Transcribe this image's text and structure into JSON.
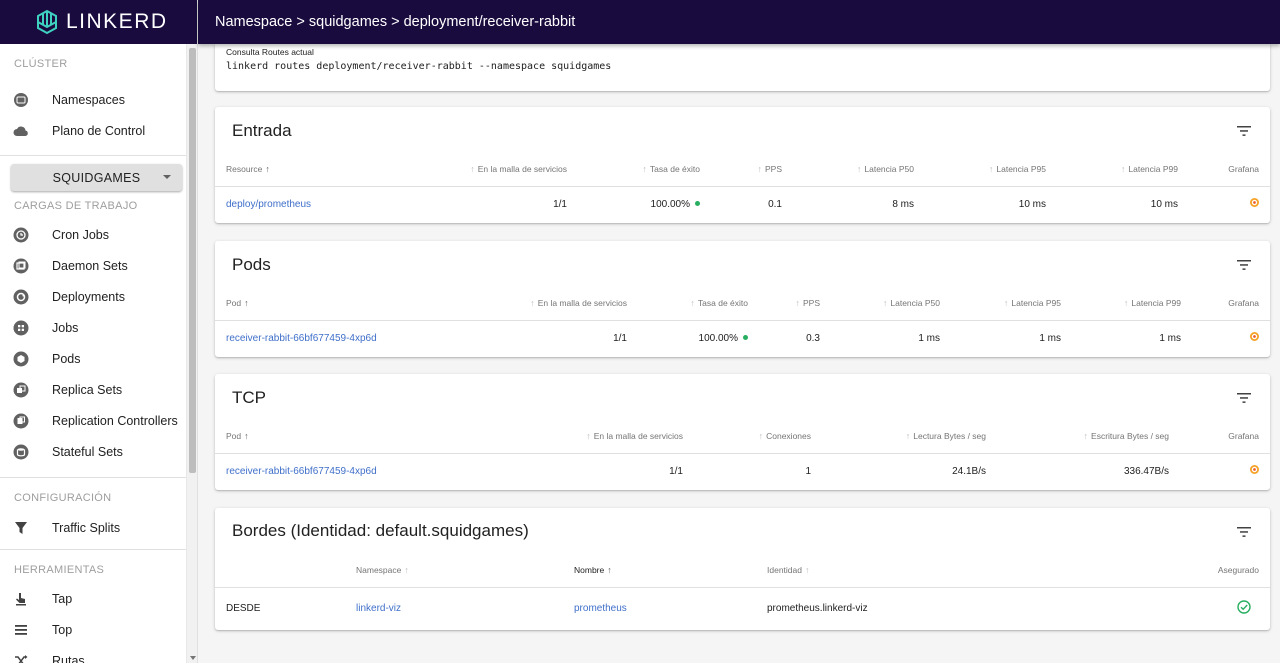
{
  "brand": {
    "name": "LINKERD",
    "color": "#1a0b3f"
  },
  "header": {
    "title": "Namespace > squidgames > deployment/receiver-rabbit"
  },
  "sidebar": {
    "cluster_label": "CLÚSTER",
    "cluster_items": [
      {
        "label": "Namespaces",
        "icon": "namespaces-icon"
      },
      {
        "label": "Plano de Control",
        "icon": "cloud-icon"
      }
    ],
    "namespace_select": "SQUIDGAMES",
    "workloads_label": "CARGAS DE TRABAJO",
    "workload_items": [
      {
        "label": "Cron Jobs",
        "icon": "cronjob-icon"
      },
      {
        "label": "Daemon Sets",
        "icon": "daemonset-icon"
      },
      {
        "label": "Deployments",
        "icon": "deployment-icon"
      },
      {
        "label": "Jobs",
        "icon": "job-icon"
      },
      {
        "label": "Pods",
        "icon": "pod-icon"
      },
      {
        "label": "Replica Sets",
        "icon": "replicaset-icon"
      },
      {
        "label": "Replication Controllers",
        "icon": "replicationcontroller-icon"
      },
      {
        "label": "Stateful Sets",
        "icon": "statefulset-icon"
      }
    ],
    "config_label": "CONFIGURACIÓN",
    "config_items": [
      {
        "label": "Traffic Splits",
        "icon": "filter-icon"
      }
    ],
    "tools_label": "HERRAMIENTAS",
    "tool_items": [
      {
        "label": "Tap",
        "icon": "tap-icon"
      },
      {
        "label": "Top",
        "icon": "top-icon"
      },
      {
        "label": "Rutas",
        "icon": "shuffle-icon"
      }
    ]
  },
  "routes_card": {
    "label": "Consulta Routes actual",
    "command": "linkerd routes deployment/receiver-rabbit --namespace squidgames"
  },
  "entrada": {
    "title": "Entrada",
    "headers": [
      "Resource",
      "En la malla de servicios",
      "Tasa de éxito",
      "PPS",
      "Latencia P50",
      "Latencia P95",
      "Latencia P99",
      "Grafana"
    ],
    "rows": [
      {
        "resource": "deploy/prometheus",
        "meshed": "1/1",
        "success": "100.00%",
        "rps": "0.1",
        "p50": "8 ms",
        "p95": "10 ms",
        "p99": "10 ms"
      }
    ]
  },
  "pods": {
    "title": "Pods",
    "headers": [
      "Pod",
      "En la malla de servicios",
      "Tasa de éxito",
      "PPS",
      "Latencia P50",
      "Latencia P95",
      "Latencia P99",
      "Grafana"
    ],
    "rows": [
      {
        "pod": "receiver-rabbit-66bf677459-4xp6d",
        "meshed": "1/1",
        "success": "100.00%",
        "rps": "0.3",
        "p50": "1 ms",
        "p95": "1 ms",
        "p99": "1 ms"
      }
    ]
  },
  "tcp": {
    "title": "TCP",
    "headers": [
      "Pod",
      "En la malla de servicios",
      "Conexiones",
      "Lectura Bytes / seg",
      "Escritura Bytes / seg",
      "Grafana"
    ],
    "rows": [
      {
        "pod": "receiver-rabbit-66bf677459-4xp6d",
        "meshed": "1/1",
        "connections": "1",
        "read": "24.1B/s",
        "write": "336.47B/s"
      }
    ]
  },
  "edges": {
    "title": "Bordes (Identidad: default.squidgames)",
    "headers": [
      "",
      "Namespace",
      "Nombre",
      "Identidad",
      "Asegurado"
    ],
    "rows": [
      {
        "direction": "DESDE",
        "namespace": "linkerd-viz",
        "name": "prometheus",
        "identity": "prometheus.linkerd-viz"
      }
    ]
  },
  "colors": {
    "success": "#27ae60",
    "link": "#3f6fc9",
    "grafana": "#f4a225"
  }
}
